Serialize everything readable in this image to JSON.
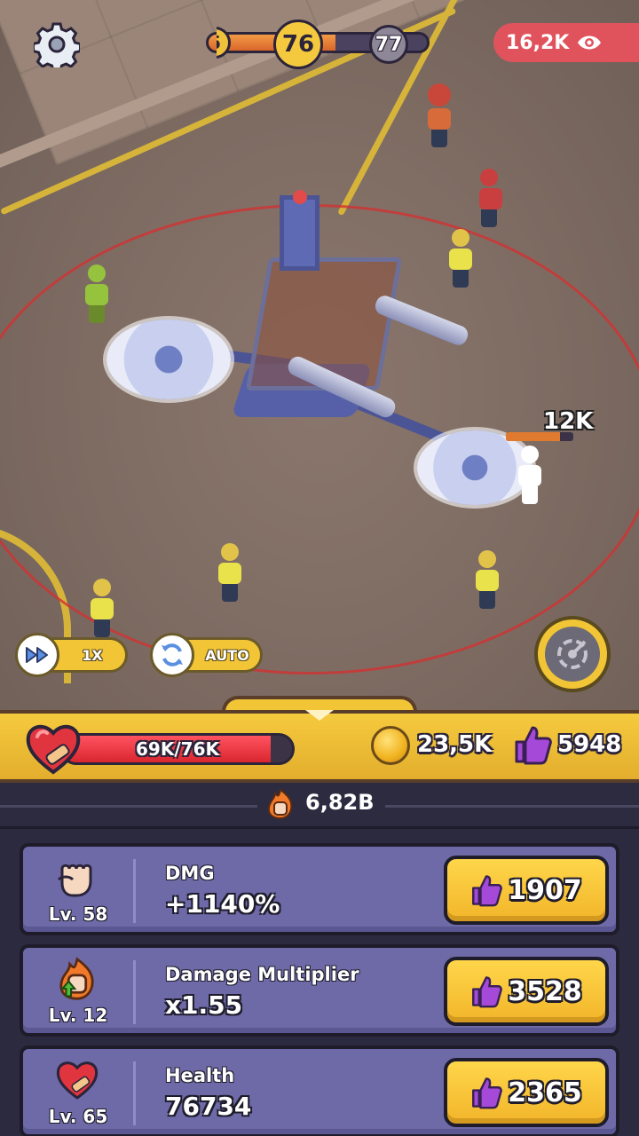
{
  "hud": {
    "level_prev": "75",
    "level_current": "76",
    "level_next": "77",
    "level_progress": 0.58,
    "viewers": "16,2K"
  },
  "scene": {
    "floating_damage": "12K",
    "enemy_hp_fraction": 0.8
  },
  "controls": {
    "speed_label": "1X",
    "auto_label": "AUTO"
  },
  "status": {
    "health_text": "69K/76K",
    "health_fraction": 0.908,
    "coins": "23,5K",
    "likes": "5948",
    "total_power": "6,82B"
  },
  "upgrades": [
    {
      "icon": "fist-icon",
      "level": "Lv. 58",
      "name": "DMG",
      "value": "+1140%",
      "cost": "1907"
    },
    {
      "icon": "fire-fist-icon",
      "level": "Lv. 12",
      "name": "Damage Multiplier",
      "value": "x1.55",
      "cost": "3528"
    },
    {
      "icon": "heart-bandage-icon",
      "level": "Lv. 65",
      "name": "Health",
      "value": "76734",
      "cost": "2365"
    }
  ],
  "colors": {
    "accent_yellow": "#f2c536",
    "panel_purple": "#6d6aa7",
    "health_red": "#e0353f",
    "like_purple": "#a54ad8"
  }
}
